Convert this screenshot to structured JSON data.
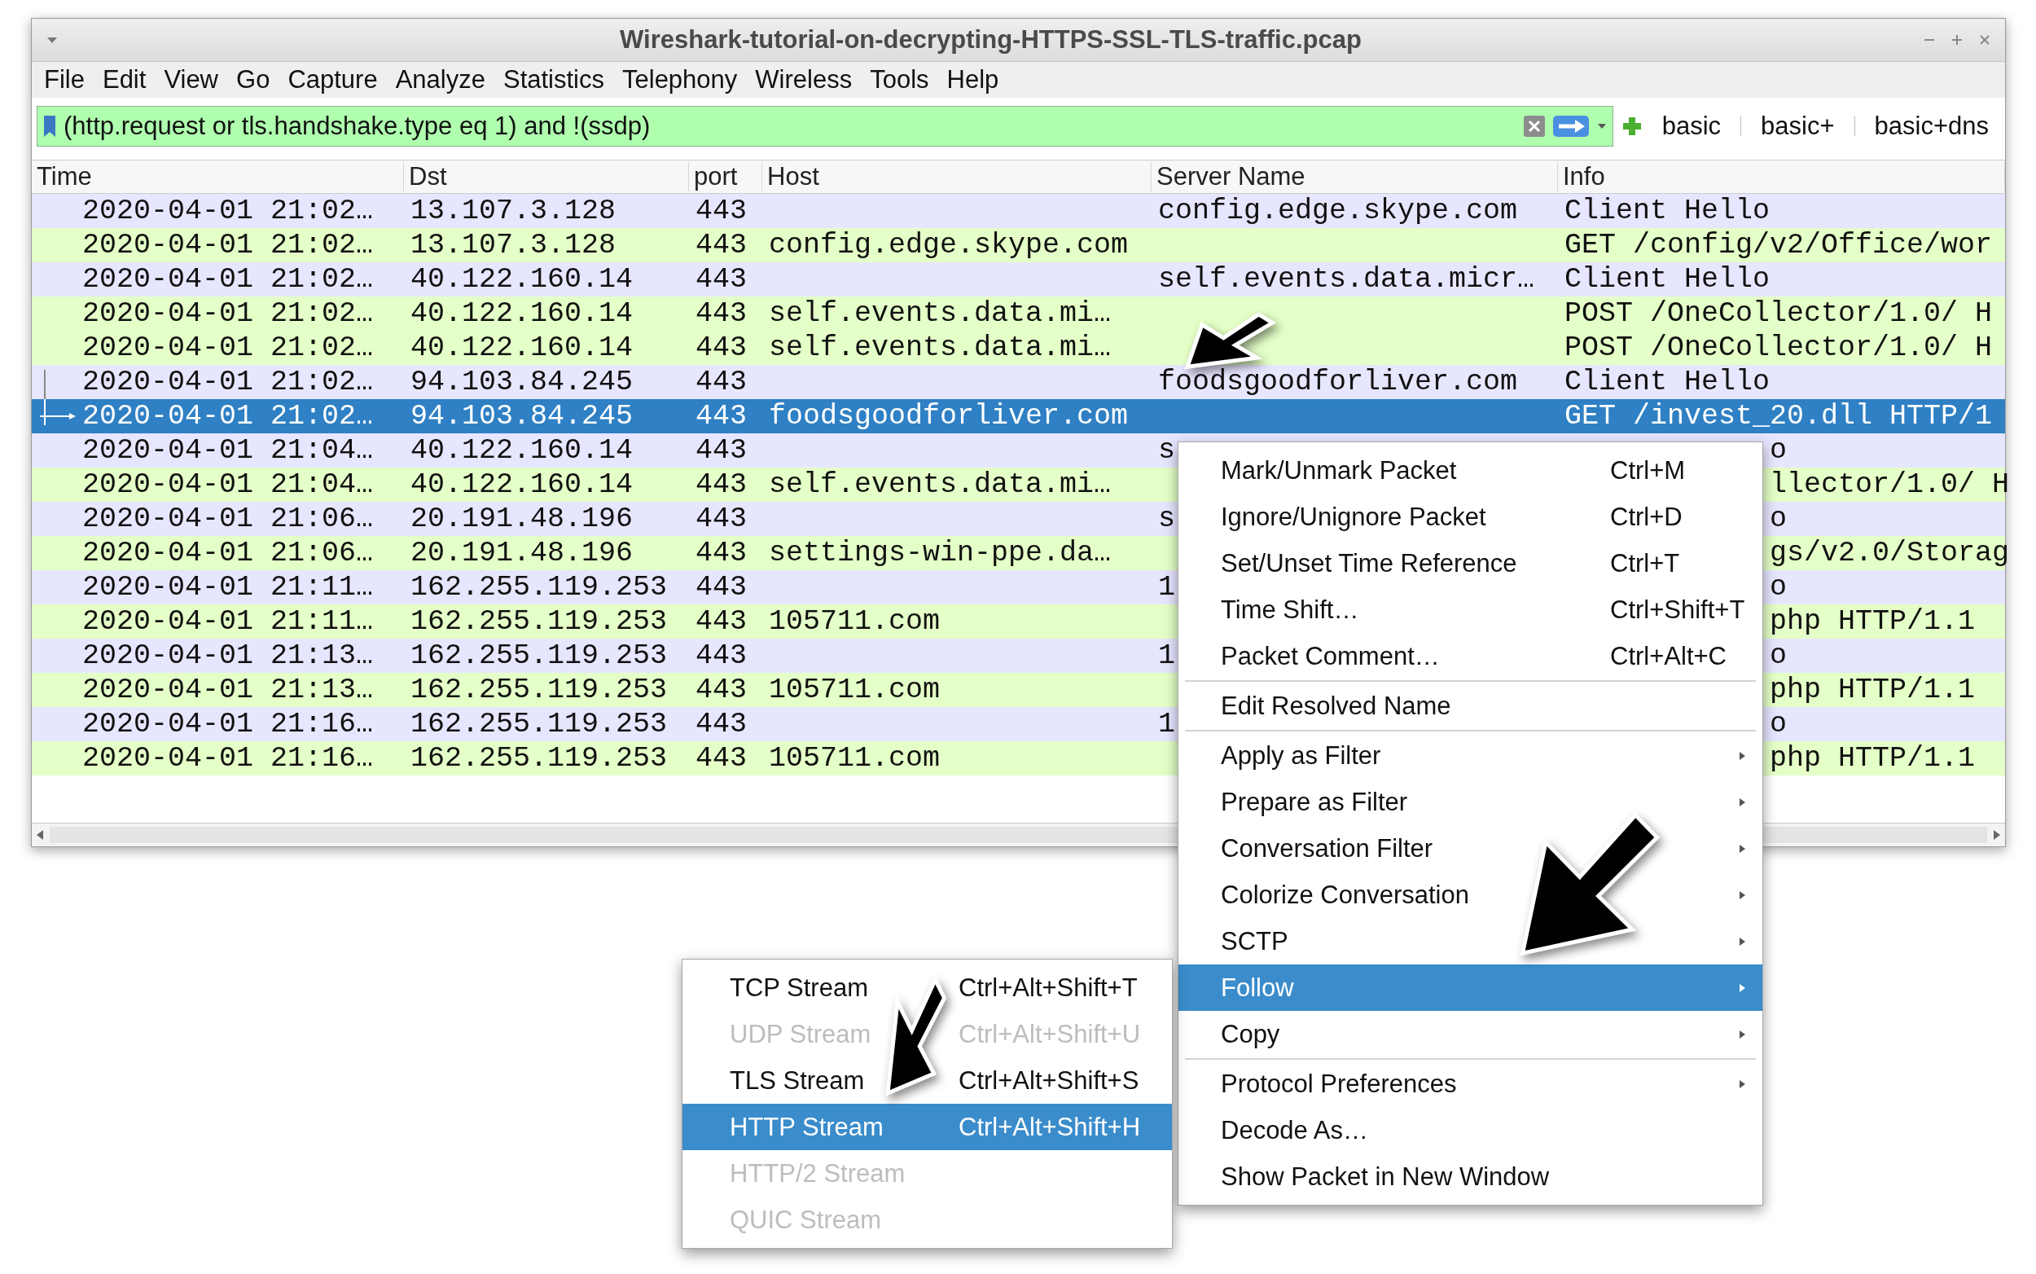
{
  "window": {
    "title": "Wireshark-tutorial-on-decrypting-HTTPS-SSL-TLS-traffic.pcap"
  },
  "menu_bar": [
    "File",
    "Edit",
    "View",
    "Go",
    "Capture",
    "Analyze",
    "Statistics",
    "Telephony",
    "Wireless",
    "Tools",
    "Help"
  ],
  "filter_bar": {
    "value": "(http.request or tls.handshake.type eq 1) and !(ssdp)",
    "buttons": [
      "basic",
      "basic+",
      "basic+dns"
    ]
  },
  "table": {
    "columns": [
      "Time",
      "Dst",
      "port",
      "Host",
      "Server Name",
      "Info"
    ],
    "rows": [
      {
        "time": "2020-04-01 21:02…",
        "dst": "13.107.3.128",
        "port": "443",
        "server_name": "config.edge.skype.com",
        "info": "Client Hello",
        "color": "#e7e6ff",
        "selected": false
      },
      {
        "time": "2020-04-01 21:02…",
        "dst": "13.107.3.128",
        "port": "443",
        "host": "config.edge.skype.com",
        "info": "GET /config/v2/Office/wor",
        "color": "#e4ffc7",
        "selected": false
      },
      {
        "time": "2020-04-01 21:02…",
        "dst": "40.122.160.14",
        "port": "443",
        "server_name": "self.events.data.micr…",
        "info": "Client Hello",
        "color": "#e7e6ff",
        "selected": false
      },
      {
        "time": "2020-04-01 21:02…",
        "dst": "40.122.160.14",
        "port": "443",
        "host": "self.events.data.mi…",
        "info": "POST /OneCollector/1.0/ H",
        "color": "#e4ffc7",
        "selected": false
      },
      {
        "time": "2020-04-01 21:02…",
        "dst": "40.122.160.14",
        "port": "443",
        "host": "self.events.data.mi…",
        "info": "POST /OneCollector/1.0/ H",
        "color": "#e4ffc7",
        "selected": false
      },
      {
        "time": "2020-04-01 21:02…",
        "dst": "94.103.84.245",
        "port": "443",
        "server_name": "foodsgoodforliver.com",
        "info": "Client Hello",
        "color": "#e7e6ff",
        "selected": false,
        "related": true
      },
      {
        "time": "2020-04-01 21:02…",
        "dst": "94.103.84.245",
        "port": "443",
        "host": "foodsgoodforliver.com",
        "info": "GET /invest_20.dll HTTP/1",
        "selected": true,
        "related": true
      },
      {
        "time": "2020-04-01 21:04…",
        "dst": "40.122.160.14",
        "port": "443",
        "server_name": "s",
        "info": "o",
        "color": "#e7e6ff",
        "selected": false
      },
      {
        "time": "2020-04-01 21:04…",
        "dst": "40.122.160.14",
        "port": "443",
        "host": "self.events.data.mi…",
        "info": "llector/1.0/ H",
        "color": "#e4ffc7",
        "selected": false
      },
      {
        "time": "2020-04-01 21:06…",
        "dst": "20.191.48.196",
        "port": "443",
        "server_name": "s",
        "info": "o",
        "color": "#e7e6ff",
        "selected": false
      },
      {
        "time": "2020-04-01 21:06…",
        "dst": "20.191.48.196",
        "port": "443",
        "host": "settings-win-ppe.da…",
        "info": "gs/v2.0/Storag",
        "color": "#e4ffc7",
        "selected": false
      },
      {
        "time": "2020-04-01 21:11…",
        "dst": "162.255.119.253",
        "port": "443",
        "server_name": "1",
        "info": "o",
        "color": "#e7e6ff",
        "selected": false
      },
      {
        "time": "2020-04-01 21:11…",
        "dst": "162.255.119.253",
        "port": "443",
        "host": "105711.com",
        "info": "php HTTP/1.1",
        "color": "#e4ffc7",
        "selected": false
      },
      {
        "time": "2020-04-01 21:13…",
        "dst": "162.255.119.253",
        "port": "443",
        "server_name": "1",
        "info": "o",
        "color": "#e7e6ff",
        "selected": false
      },
      {
        "time": "2020-04-01 21:13…",
        "dst": "162.255.119.253",
        "port": "443",
        "host": "105711.com",
        "info": "php HTTP/1.1",
        "color": "#e4ffc7",
        "selected": false
      },
      {
        "time": "2020-04-01 21:16…",
        "dst": "162.255.119.253",
        "port": "443",
        "server_name": "1",
        "info": "o",
        "color": "#e7e6ff",
        "selected": false
      },
      {
        "time": "2020-04-01 21:16…",
        "dst": "162.255.119.253",
        "port": "443",
        "host": "105711.com",
        "info": "php HTTP/1.1",
        "color": "#e4ffc7",
        "selected": false
      }
    ]
  },
  "context_menu": {
    "items": [
      {
        "kind": "item",
        "label": "Mark/Unmark Packet",
        "shortcut": "Ctrl+M",
        "submenu": false,
        "selected": false
      },
      {
        "kind": "item",
        "label": "Ignore/Unignore Packet",
        "shortcut": "Ctrl+D",
        "submenu": false,
        "selected": false
      },
      {
        "kind": "item",
        "label": "Set/Unset Time Reference",
        "shortcut": "Ctrl+T",
        "submenu": false,
        "selected": false
      },
      {
        "kind": "item",
        "label": "Time Shift…",
        "shortcut": "Ctrl+Shift+T",
        "submenu": false,
        "selected": false
      },
      {
        "kind": "item",
        "label": "Packet Comment…",
        "shortcut": "Ctrl+Alt+C",
        "submenu": false,
        "selected": false
      },
      {
        "kind": "separator"
      },
      {
        "kind": "item",
        "label": "Edit Resolved Name",
        "submenu": false,
        "selected": false
      },
      {
        "kind": "separator"
      },
      {
        "kind": "item",
        "label": "Apply as Filter",
        "submenu": true,
        "selected": false
      },
      {
        "kind": "item",
        "label": "Prepare as Filter",
        "submenu": true,
        "selected": false
      },
      {
        "kind": "item",
        "label": "Conversation Filter",
        "submenu": true,
        "selected": false
      },
      {
        "kind": "item",
        "label": "Colorize Conversation",
        "submenu": true,
        "selected": false
      },
      {
        "kind": "item",
        "label": "SCTP",
        "submenu": true,
        "selected": false
      },
      {
        "kind": "item",
        "label": "Follow",
        "submenu": true,
        "selected": true
      },
      {
        "kind": "item",
        "label": "Copy",
        "submenu": true,
        "selected": false
      },
      {
        "kind": "separator"
      },
      {
        "kind": "item",
        "label": "Protocol Preferences",
        "submenu": true,
        "selected": false
      },
      {
        "kind": "item",
        "label": "Decode As…",
        "submenu": false,
        "selected": false
      },
      {
        "kind": "item",
        "label": "Show Packet in New Window",
        "submenu": false,
        "selected": false
      }
    ]
  },
  "follow_submenu": {
    "items": [
      {
        "label": "TCP Stream",
        "shortcut": "Ctrl+Alt+Shift+T",
        "disabled": false,
        "selected": false
      },
      {
        "label": "UDP Stream",
        "shortcut": "Ctrl+Alt+Shift+U",
        "disabled": true,
        "selected": false
      },
      {
        "label": "TLS Stream",
        "shortcut": "Ctrl+Alt+Shift+S",
        "disabled": false,
        "selected": false
      },
      {
        "label": "HTTP Stream",
        "shortcut": "Ctrl+Alt+Shift+H",
        "disabled": false,
        "selected": true
      },
      {
        "label": "HTTP/2 Stream",
        "disabled": true,
        "selected": false
      },
      {
        "label": "QUIC Stream",
        "disabled": true,
        "selected": false
      }
    ]
  }
}
